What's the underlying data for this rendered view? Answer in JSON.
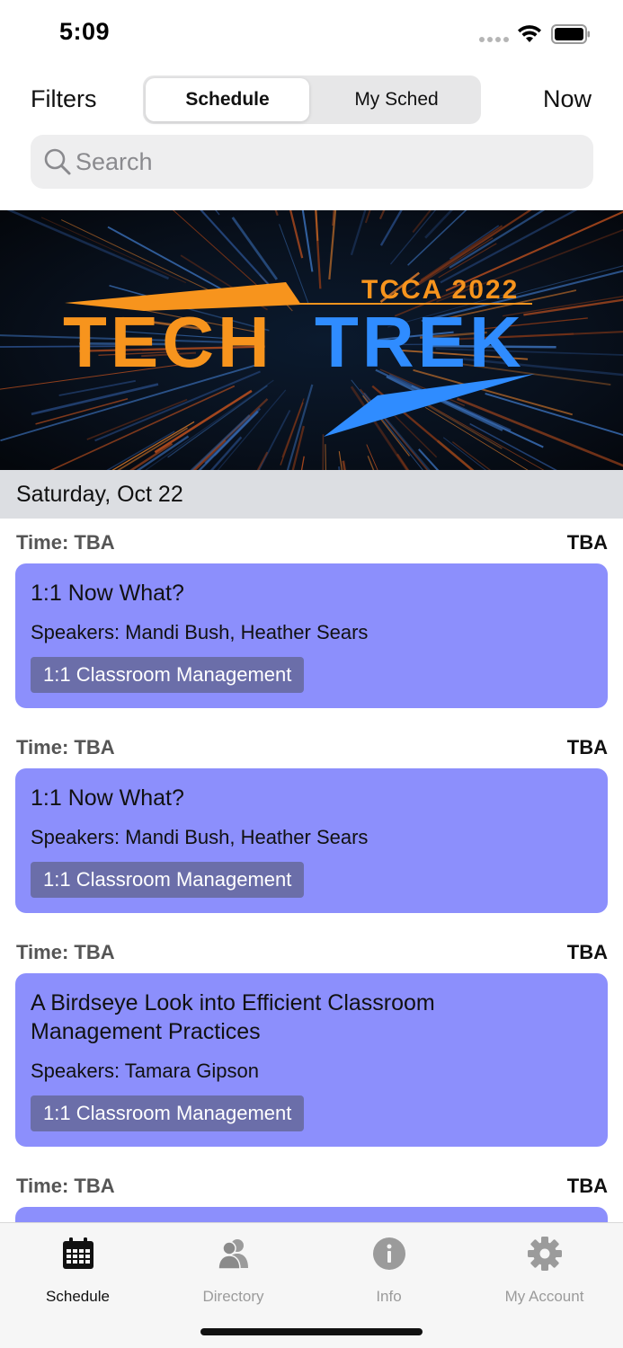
{
  "status_bar": {
    "time": "5:09"
  },
  "header": {
    "filters_label": "Filters",
    "now_label": "Now",
    "segments": [
      {
        "label": "Schedule",
        "selected": true
      },
      {
        "label": "My Sched",
        "selected": false
      }
    ]
  },
  "search": {
    "placeholder": "Search"
  },
  "banner": {
    "subtitle": "TCCA 2022",
    "word_left": "TECH",
    "word_right": "TREK"
  },
  "day_header": "Saturday, Oct 22",
  "sessions": [
    {
      "time": "Time: TBA",
      "location": "TBA",
      "title": "1:1 Now What?",
      "speakers": "Speakers: Mandi Bush, Heather Sears",
      "tag": "1:1 Classroom Management"
    },
    {
      "time": "Time: TBA",
      "location": "TBA",
      "title": "1:1 Now What?",
      "speakers": "Speakers: Mandi Bush, Heather Sears",
      "tag": "1:1 Classroom Management"
    },
    {
      "time": "Time: TBA",
      "location": "TBA",
      "title": "A Birdseye Look into Efficient Classroom Management Practices",
      "speakers": "Speakers: Tamara Gipson",
      "tag": "1:1 Classroom Management"
    },
    {
      "time": "Time: TBA",
      "location": "TBA"
    }
  ],
  "tab_bar": {
    "tabs": [
      {
        "label": "Schedule",
        "icon": "calendar-icon",
        "active": true
      },
      {
        "label": "Directory",
        "icon": "people-icon",
        "active": false
      },
      {
        "label": "Info",
        "icon": "info-icon",
        "active": false
      },
      {
        "label": "My Account",
        "icon": "gear-icon",
        "active": false
      }
    ]
  },
  "colors": {
    "card": "#8c8ffc",
    "tag": "#6b6ea9",
    "banner_orange": "#f7941d",
    "banner_blue": "#2f8cff"
  }
}
